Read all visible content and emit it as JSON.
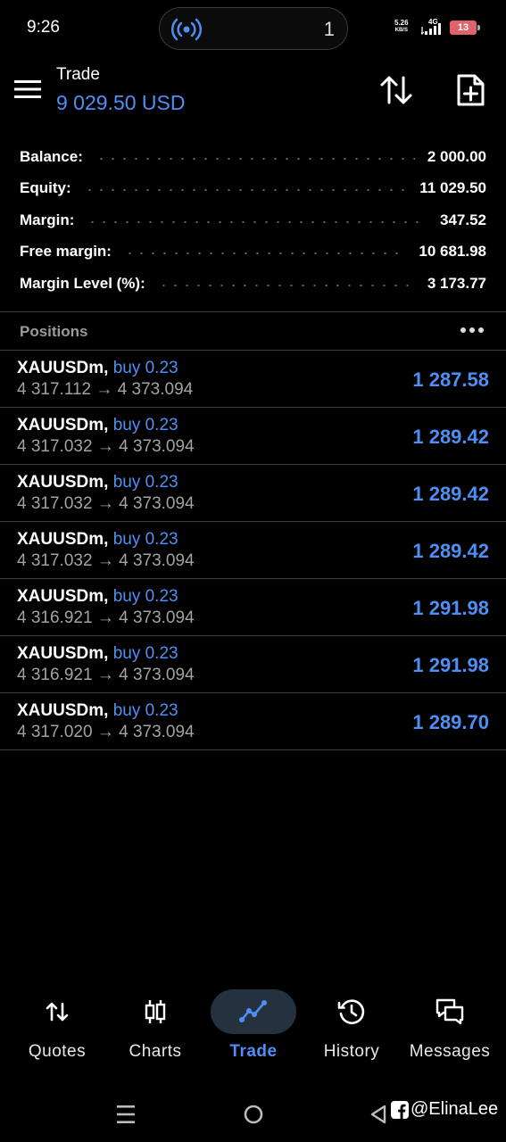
{
  "status_bar": {
    "time": "9:26",
    "island_number": "1",
    "net_speed_value": "5.26",
    "net_speed_unit": "KB/S",
    "network_type": "4G",
    "battery_level": "13"
  },
  "header": {
    "label": "Trade",
    "balance": "9 029.50 USD"
  },
  "summary": [
    {
      "label": "Balance:",
      "value": "2 000.00"
    },
    {
      "label": "Equity:",
      "value": "11 029.50"
    },
    {
      "label": "Margin:",
      "value": "347.52"
    },
    {
      "label": "Free margin:",
      "value": "10 681.98"
    },
    {
      "label": "Margin Level (%):",
      "value": "3 173.77"
    }
  ],
  "positions": {
    "title": "Positions",
    "items": [
      {
        "symbol": "XAUUSDm,",
        "side": "buy 0.23",
        "open": "4 317.112",
        "arrow": "→",
        "current": "4 373.094",
        "profit": "1 287.58"
      },
      {
        "symbol": "XAUUSDm,",
        "side": "buy 0.23",
        "open": "4 317.032",
        "arrow": "→",
        "current": "4 373.094",
        "profit": "1 289.42"
      },
      {
        "symbol": "XAUUSDm,",
        "side": "buy 0.23",
        "open": "4 317.032",
        "arrow": "→",
        "current": "4 373.094",
        "profit": "1 289.42"
      },
      {
        "symbol": "XAUUSDm,",
        "side": "buy 0.23",
        "open": "4 317.032",
        "arrow": "→",
        "current": "4 373.094",
        "profit": "1 289.42"
      },
      {
        "symbol": "XAUUSDm,",
        "side": "buy 0.23",
        "open": "4 316.921",
        "arrow": "→",
        "current": "4 373.094",
        "profit": "1 291.98"
      },
      {
        "symbol": "XAUUSDm,",
        "side": "buy 0.23",
        "open": "4 316.921",
        "arrow": "→",
        "current": "4 373.094",
        "profit": "1 291.98"
      },
      {
        "symbol": "XAUUSDm,",
        "side": "buy 0.23",
        "open": "4 317.020",
        "arrow": "→",
        "current": "4 373.094",
        "profit": "1 289.70"
      }
    ]
  },
  "nav": [
    {
      "label": "Quotes",
      "icon": "quotes-arrows-icon"
    },
    {
      "label": "Charts",
      "icon": "candlestick-icon"
    },
    {
      "label": "Trade",
      "icon": "trade-line-icon",
      "active": true
    },
    {
      "label": "History",
      "icon": "history-clock-icon"
    },
    {
      "label": "Messages",
      "icon": "chat-bubbles-icon"
    }
  ],
  "watermark": "@ElinaLee",
  "colors": {
    "accent": "#4d8ff5",
    "background": "#000000",
    "active_pill": "#25313f",
    "battery": "#e0626a"
  }
}
